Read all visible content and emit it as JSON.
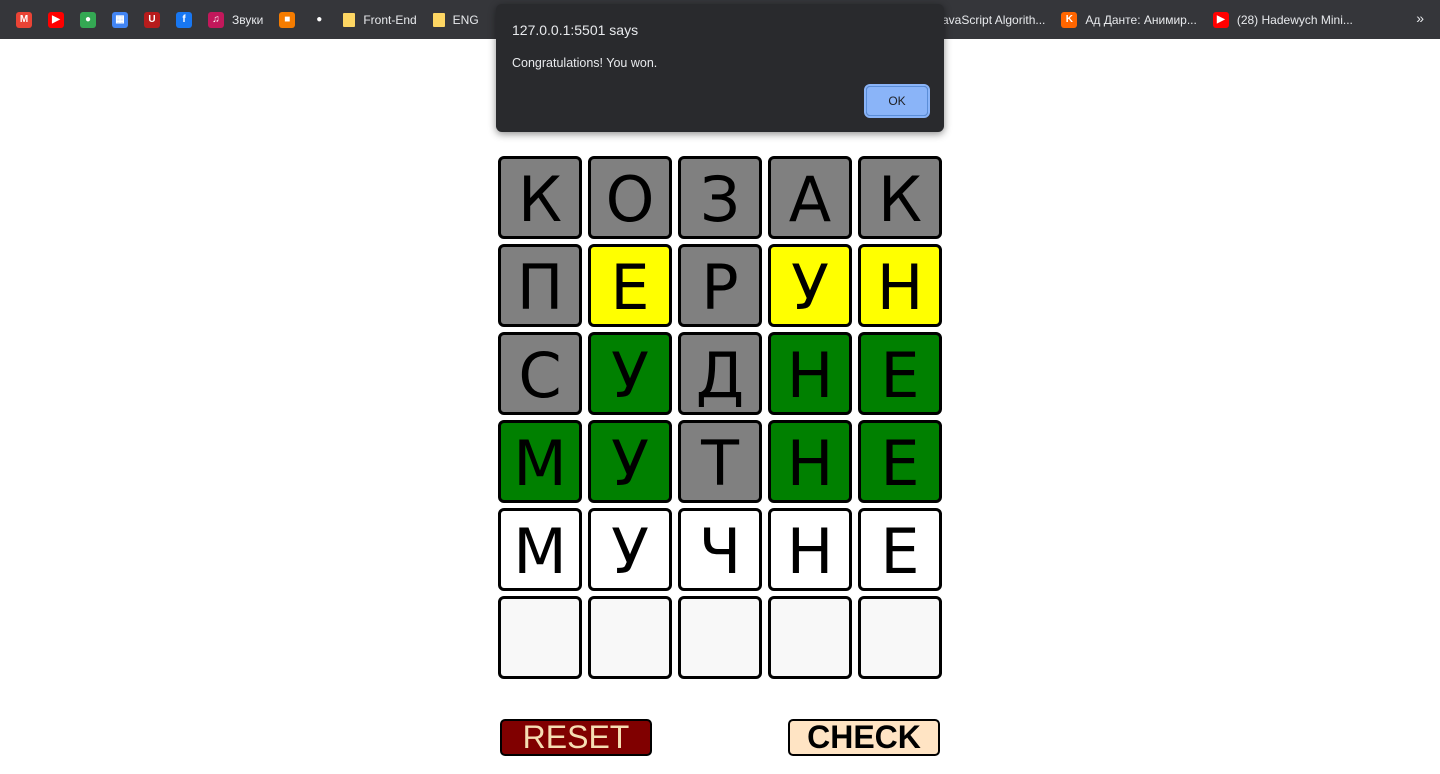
{
  "bookmarks": [
    {
      "icon": "gmail-icon",
      "label": "",
      "color": "#ea4335",
      "glyph": "M"
    },
    {
      "icon": "youtube-icon",
      "label": "",
      "color": "#ff0000",
      "glyph": "▶"
    },
    {
      "icon": "maps-icon",
      "label": "",
      "color": "#34a853",
      "glyph": "●"
    },
    {
      "icon": "calendar-icon",
      "label": "",
      "color": "#4285f4",
      "glyph": "▦"
    },
    {
      "icon": "ublock-icon",
      "label": "",
      "color": "#b71c1c",
      "glyph": "U"
    },
    {
      "icon": "facebook-icon",
      "label": "",
      "color": "#1877f2",
      "glyph": "f"
    },
    {
      "icon": "sounds-icon",
      "label": "Звуки",
      "color": "#c2185b",
      "glyph": "♫"
    },
    {
      "icon": "box-icon",
      "label": "",
      "color": "#f57c00",
      "glyph": "■"
    },
    {
      "icon": "github-icon",
      "label": "",
      "color": "#35363a",
      "glyph": "●"
    },
    {
      "icon": "folder-icon",
      "label": "Front-End",
      "color": "#fdd663",
      "glyph": ""
    },
    {
      "icon": "folder-icon",
      "label": "ENG",
      "color": "#fdd663",
      "glyph": ""
    }
  ],
  "bookmarks_right": [
    {
      "icon": "",
      "label": "JavaScript Algorith...",
      "color": "",
      "glyph": ""
    },
    {
      "icon": "kinopoisk-icon",
      "label": "Ад Данте: Анимир...",
      "color": "#ff6600",
      "glyph": "K"
    },
    {
      "icon": "youtube-icon",
      "label": "(28) Hadewych Mini...",
      "color": "#ff0000",
      "glyph": "▶"
    }
  ],
  "overflow": "»",
  "alert": {
    "title": "127.0.0.1:5501 says",
    "message": "Congratulations! You won.",
    "ok_label": "OK"
  },
  "board": {
    "rows": [
      [
        {
          "letter": "К",
          "state": "gray"
        },
        {
          "letter": "О",
          "state": "gray"
        },
        {
          "letter": "З",
          "state": "gray"
        },
        {
          "letter": "А",
          "state": "gray"
        },
        {
          "letter": "К",
          "state": "gray"
        }
      ],
      [
        {
          "letter": "П",
          "state": "gray"
        },
        {
          "letter": "Е",
          "state": "yellow"
        },
        {
          "letter": "Р",
          "state": "gray"
        },
        {
          "letter": "У",
          "state": "yellow"
        },
        {
          "letter": "Н",
          "state": "yellow"
        }
      ],
      [
        {
          "letter": "С",
          "state": "gray"
        },
        {
          "letter": "У",
          "state": "green"
        },
        {
          "letter": "Д",
          "state": "gray"
        },
        {
          "letter": "Н",
          "state": "green"
        },
        {
          "letter": "Е",
          "state": "green"
        }
      ],
      [
        {
          "letter": "М",
          "state": "green"
        },
        {
          "letter": "У",
          "state": "green"
        },
        {
          "letter": "Т",
          "state": "gray"
        },
        {
          "letter": "Н",
          "state": "green"
        },
        {
          "letter": "Е",
          "state": "green"
        }
      ],
      [
        {
          "letter": "М",
          "state": "white"
        },
        {
          "letter": "У",
          "state": "white"
        },
        {
          "letter": "Ч",
          "state": "white"
        },
        {
          "letter": "Н",
          "state": "white"
        },
        {
          "letter": "Е",
          "state": "white"
        }
      ],
      [
        {
          "letter": "",
          "state": "empty"
        },
        {
          "letter": "",
          "state": "empty"
        },
        {
          "letter": "",
          "state": "empty"
        },
        {
          "letter": "",
          "state": "empty"
        },
        {
          "letter": "",
          "state": "empty"
        }
      ]
    ]
  },
  "buttons": {
    "reset_label": "RESET",
    "check_label": "CHECK"
  },
  "colors": {
    "gray": "#808080",
    "yellow": "#ffff00",
    "green": "#008000",
    "reset_bg": "#800000",
    "check_bg": "#ffe4c4"
  }
}
